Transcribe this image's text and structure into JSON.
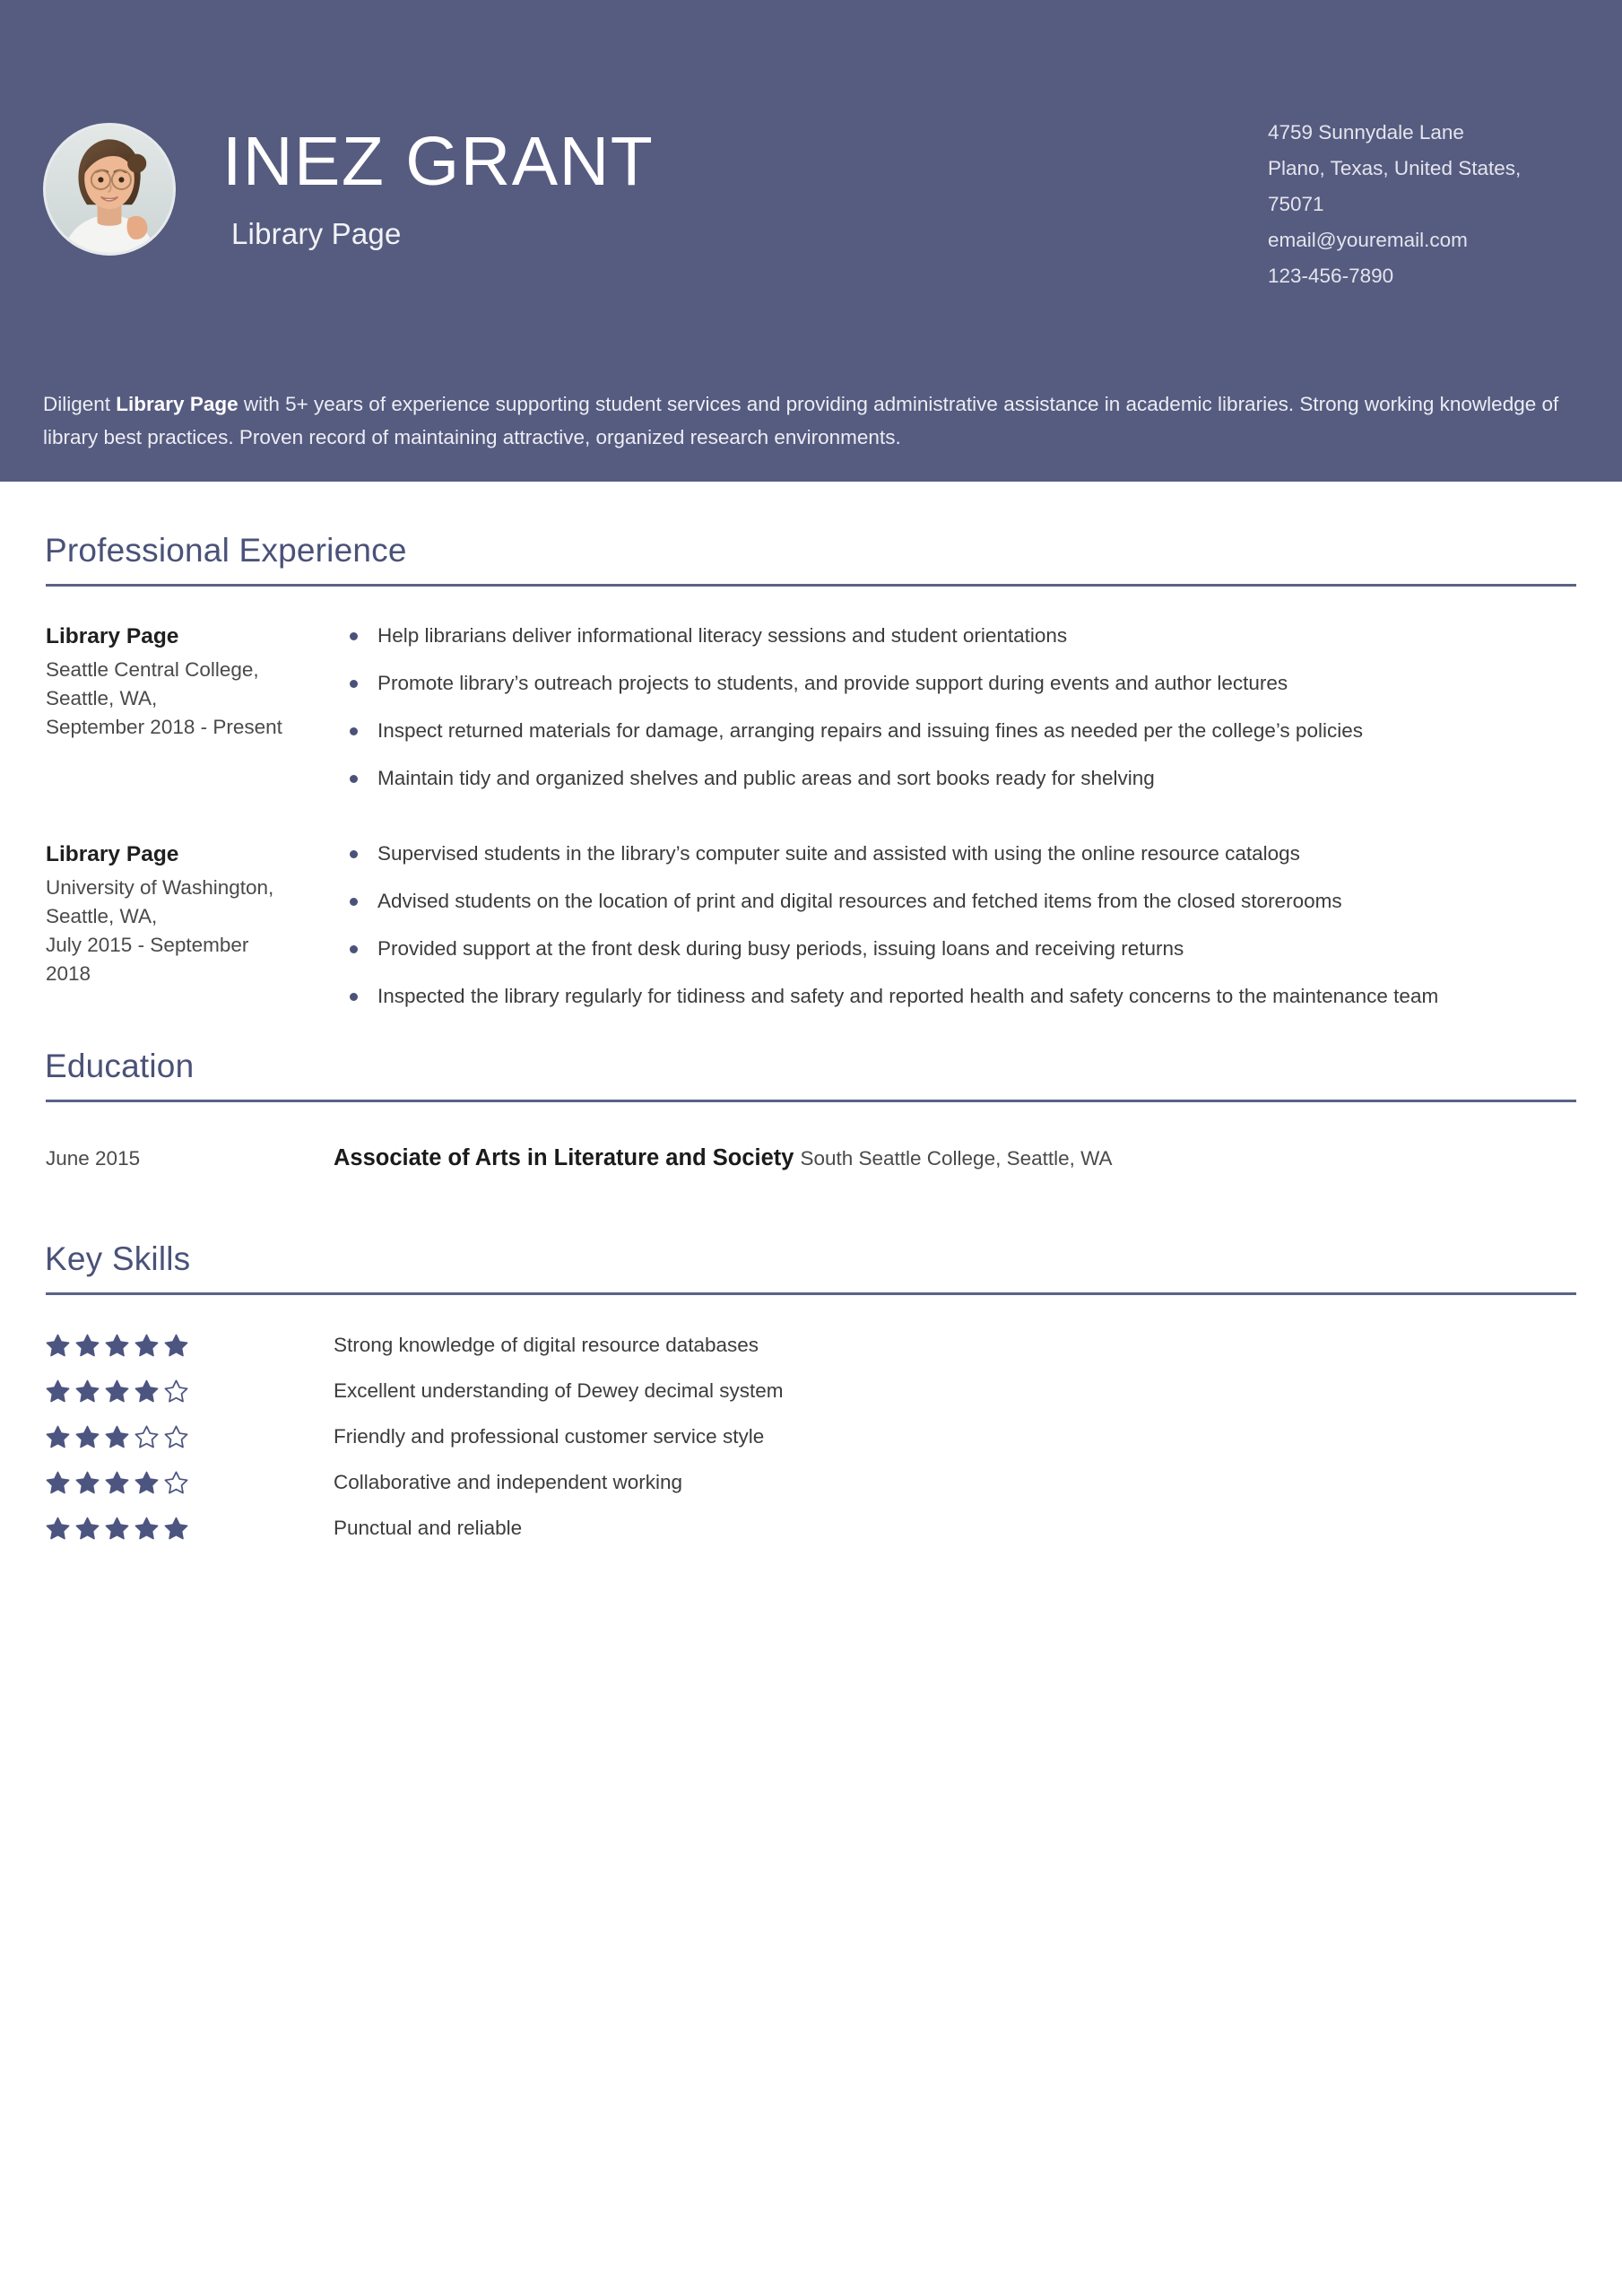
{
  "header": {
    "name": "INEZ GRANT",
    "job_title": "Library Page",
    "avatar_alt": "avatar-photo",
    "background_color": "#565b80",
    "contact": {
      "address_line1": "4759 Sunnydale Lane",
      "address_line2": "Plano, Texas, United States,",
      "postal_code": "75071",
      "email": "email@youremail.com",
      "phone": "123-456-7890"
    },
    "summary": {
      "before": "Diligent ",
      "bold": "Library Page",
      "after": " with 5+ years of experience supporting student services and providing administrative assistance in academic libraries. Strong working knowledge of library best practices. Proven record of maintaining attractive, organized research environments."
    }
  },
  "colors": {
    "accent": "#4a5278",
    "header_bg": "#565b80",
    "star": "#4c5480",
    "rule": "#5b6287"
  },
  "sections": {
    "experience": {
      "title": "Professional Experience",
      "entries": [
        {
          "role": "Library Page",
          "employer": "Seattle Central College, Seattle, WA,",
          "dates": "September 2018 - Present",
          "bullets": [
            "Help librarians deliver informational literacy sessions and student orientations",
            "Promote library’s outreach projects to students, and provide support during events and author lectures",
            "Inspect returned materials for damage, arranging repairs and issuing fines as needed per the college’s policies",
            "Maintain tidy and organized shelves and public areas and sort books ready for shelving"
          ]
        },
        {
          "role": "Library Page",
          "employer": "University of Washington, Seattle, WA,",
          "dates": "July 2015 - September 2018",
          "bullets": [
            "Supervised students in the library’s computer suite and assisted with using the online resource catalogs",
            "Advised students on the location of print and digital resources and fetched items from the closed storerooms",
            "Provided support at the front desk during busy periods, issuing loans and receiving returns",
            "Inspected the library regularly for tidiness and safety and reported health and safety concerns to the maintenance team"
          ]
        }
      ]
    },
    "education": {
      "title": "Education",
      "entries": [
        {
          "date": "June 2015",
          "degree": "Associate of Arts in Literature and Society",
          "institution": "South Seattle College, Seattle, WA"
        }
      ]
    },
    "skills": {
      "title": "Key Skills",
      "max_rating": 5,
      "items": [
        {
          "label": "Strong knowledge of digital resource databases",
          "rating": 5
        },
        {
          "label": "Excellent understanding of Dewey decimal system",
          "rating": 4
        },
        {
          "label": "Friendly and professional customer service style",
          "rating": 3
        },
        {
          "label": "Collaborative and independent working",
          "rating": 4
        },
        {
          "label": "Punctual and reliable",
          "rating": 5
        }
      ]
    }
  }
}
